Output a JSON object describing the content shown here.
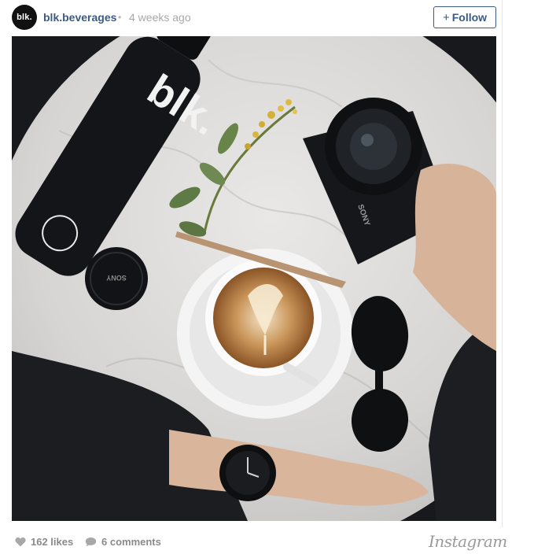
{
  "post": {
    "avatar_text": "blk.",
    "username": "blk.beverages",
    "separator": "•",
    "timestamp": "4 weeks ago",
    "follow_label": "Follow",
    "follow_icon": "plus-icon"
  },
  "photo": {
    "bottle_brand": "blk.",
    "camera_brand": "SONY",
    "lens_cap_brand": "SONY"
  },
  "footer": {
    "likes": "162 likes",
    "comments": "6 comments",
    "like_icon": "heart-icon",
    "comment_icon": "speech-bubble-icon",
    "brand": "Instagram"
  }
}
